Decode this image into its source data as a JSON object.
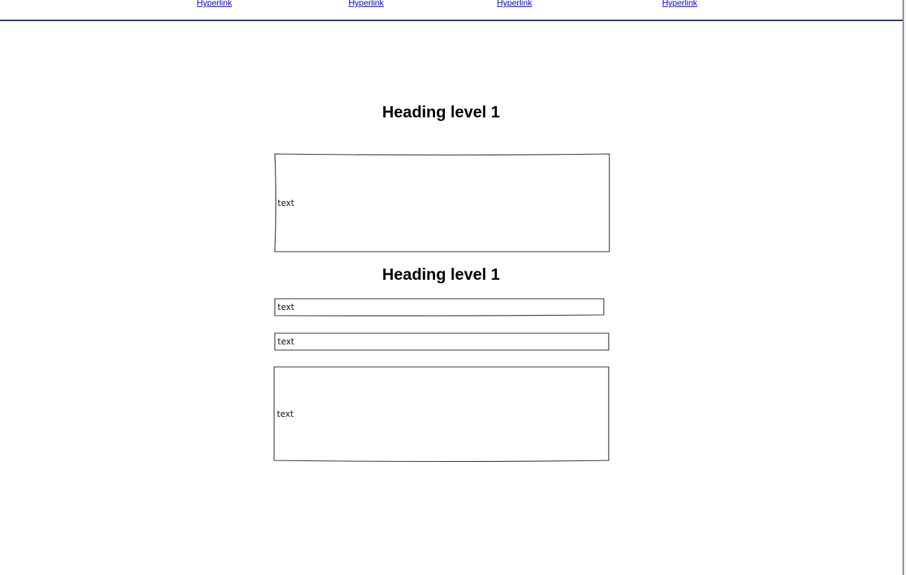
{
  "nav": {
    "links": [
      "Hyperlink",
      "Hyperlink",
      "Hyperlink",
      "Hyperlink"
    ],
    "link_color": "#0000ee",
    "rule_color": "#1f2e6f"
  },
  "main": {
    "heading_1": "Heading level 1",
    "textarea_1": "text",
    "heading_2": "Heading level 1",
    "field_1": "text",
    "field_2": "text",
    "textarea_2": "text"
  }
}
